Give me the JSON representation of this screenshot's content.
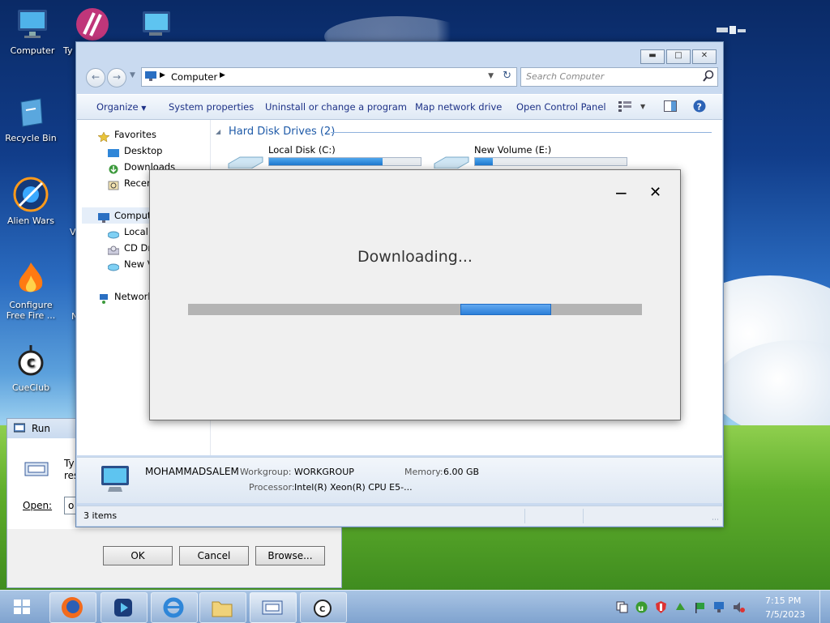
{
  "desktop": {
    "icons": [
      {
        "label": "Computer"
      },
      {
        "label": "Ty"
      },
      {
        "label": "Recycle Bin"
      },
      {
        "label": "Alien Wars"
      },
      {
        "label": "Configure Free Fire ..."
      },
      {
        "label": "CueClub"
      }
    ],
    "partial_labels": [
      "V",
      "N"
    ]
  },
  "explorer": {
    "address": "Computer",
    "search_placeholder": "Search Computer",
    "toolbar": {
      "organize": "Organize",
      "system_properties": "System properties",
      "uninstall": "Uninstall or change a program",
      "map_drive": "Map network drive",
      "control_panel": "Open Control Panel"
    },
    "nav": {
      "favorites": "Favorites",
      "desktop": "Desktop",
      "downloads": "Downloads",
      "recent": "Recen",
      "computer": "Comput",
      "local_disk": "Local D",
      "cd_drive": "CD Dri",
      "new_volume": "New V",
      "network": "Network"
    },
    "group_header": "Hard Disk Drives (2)",
    "drives": [
      {
        "name": "Local Disk (C:)",
        "used_fraction": 0.75
      },
      {
        "name": "New Volume (E:)",
        "used_fraction": 0.12
      }
    ],
    "details": {
      "computer_name": "MOHAMMADSALEM",
      "workgroup_label": "Workgroup:",
      "workgroup": "WORKGROUP",
      "memory_label": "Memory:",
      "memory": "6.00 GB",
      "processor_label": "Processor:",
      "processor": "Intel(R) Xeon(R) CPU E5-..."
    },
    "status": "3 items"
  },
  "dialog": {
    "message": "Downloading...",
    "minimize": "−",
    "close": "✕",
    "progress": {
      "start_fraction": 0.6,
      "end_fraction": 0.8
    }
  },
  "run": {
    "title": "Run",
    "description_line1": "Ty",
    "description_line2": "res",
    "open_label": "Open:",
    "open_value": "o",
    "ok": "OK",
    "cancel": "Cancel",
    "browse": "Browse..."
  },
  "taskbar": {
    "time": "7:15 PM",
    "date": "7/5/2023"
  },
  "colors": {
    "accent_blue": "#2f86d8",
    "link_blue": "#1e3287",
    "header_blue": "#1e5aa8"
  }
}
